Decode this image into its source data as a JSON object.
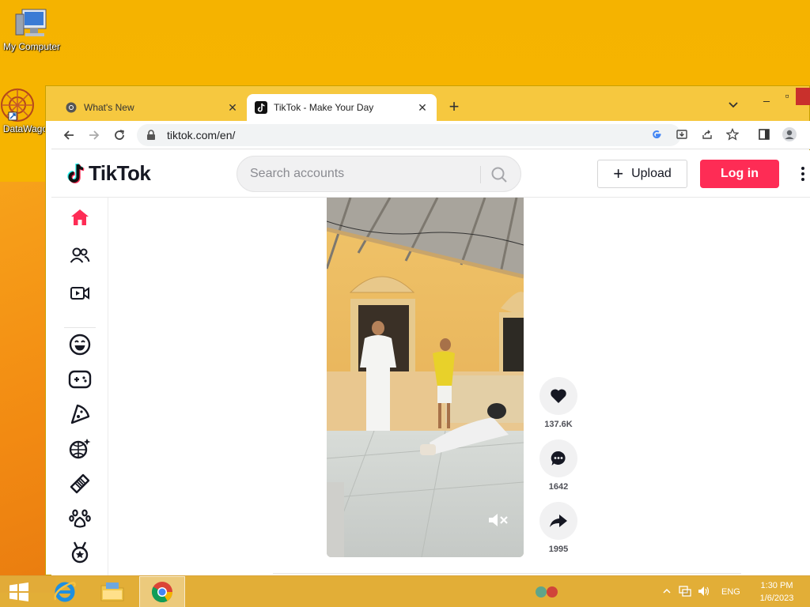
{
  "desktop": {
    "icons": [
      {
        "label": "My Computer"
      },
      {
        "label": "DataWago"
      }
    ]
  },
  "browser": {
    "tabs": [
      {
        "title": "What's New",
        "icon": "chrome-icon",
        "active": false
      },
      {
        "title": "TikTok - Make Your Day",
        "icon": "tiktok-icon",
        "active": true
      }
    ],
    "url": "tiktok.com/en/"
  },
  "tiktok": {
    "logo_text": "TikTok",
    "search_placeholder": "Search accounts",
    "upload_label": "Upload",
    "login_label": "Log in",
    "sidebar_icons": [
      "home-icon",
      "following-icon",
      "live-icon",
      "comedy-icon",
      "gaming-icon",
      "food-icon",
      "dance-icon",
      "beauty-icon",
      "animals-icon",
      "sports-icon"
    ],
    "actions": {
      "likes": "137.6K",
      "comments": "1642",
      "shares": "1995"
    },
    "accent_color": "#fe2c55"
  },
  "taskbar": {
    "tray_language": "ENG",
    "time": "1:30 PM",
    "date": "1/6/2023"
  }
}
